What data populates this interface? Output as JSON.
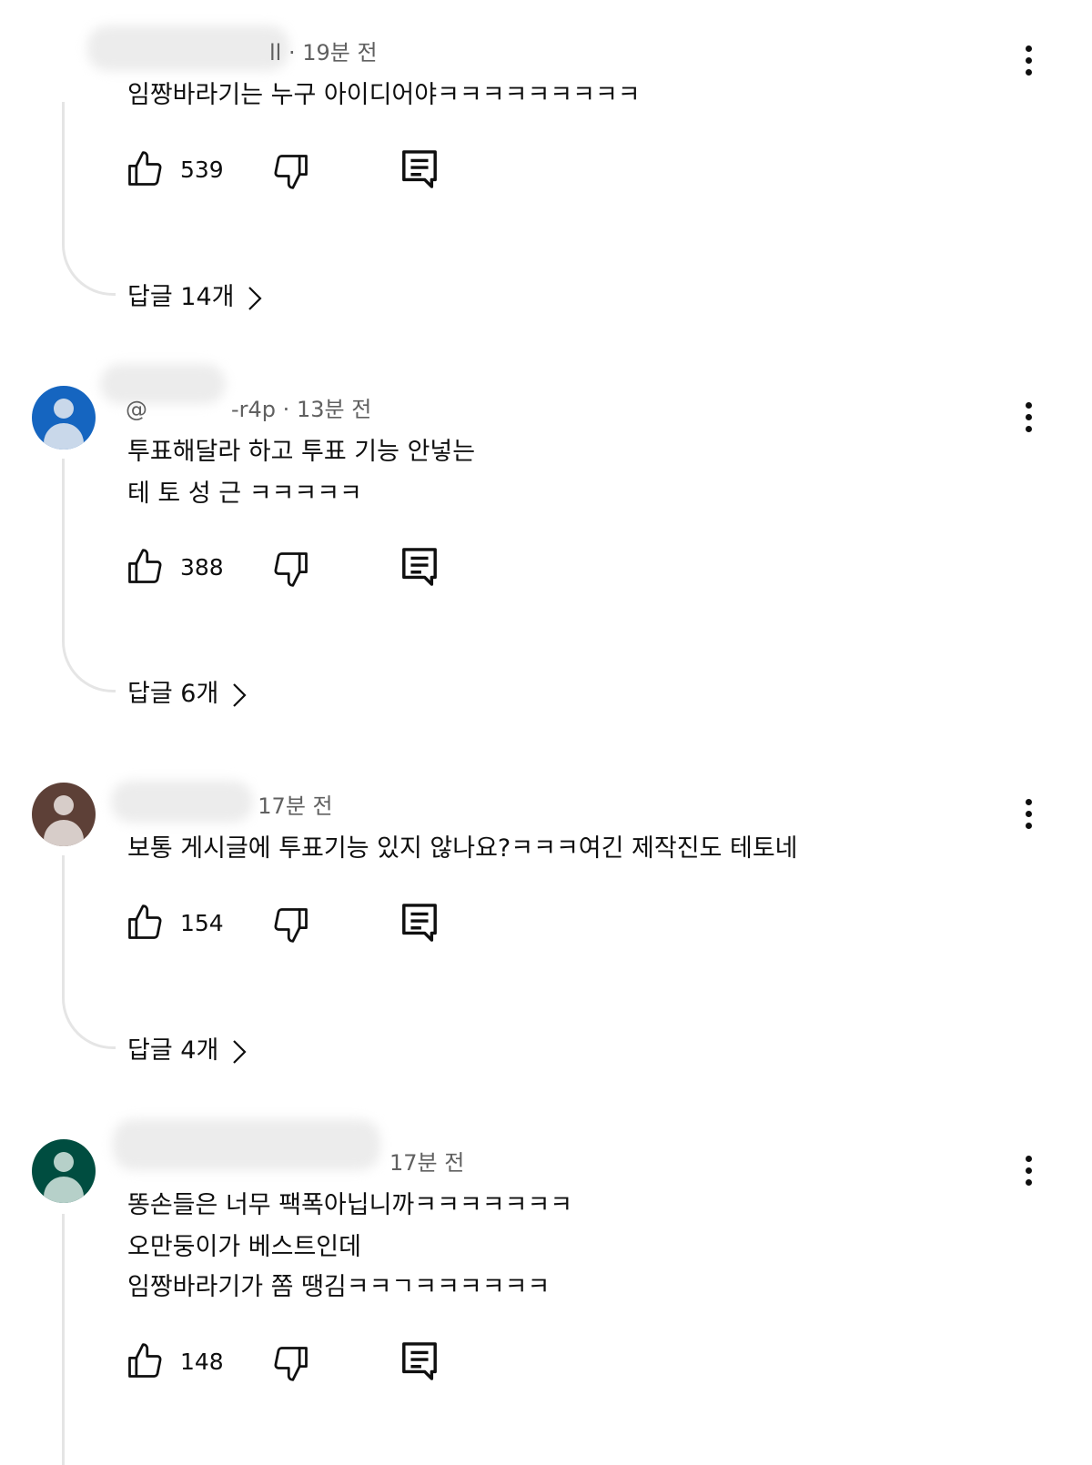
{
  "comments": [
    {
      "handle_suffix": "ll",
      "separator": "·",
      "time": "19분 전",
      "text_lines": [
        "임짱바라기는 누구 아이디어야ㅋㅋㅋㅋㅋㅋㅋㅋㅋ"
      ],
      "likes": "539",
      "replies_label": "답글 14개",
      "avatar_color": null
    },
    {
      "handle_prefix": "@",
      "handle_suffix": "-r4p",
      "separator": "·",
      "time": "13분 전",
      "text_lines": [
        "투표해달라 하고 투표 기능 안넣는",
        "테 토 성 근 ㅋㅋㅋㅋㅋ"
      ],
      "likes": "388",
      "replies_label": "답글 6개",
      "avatar_color": "#1565c0"
    },
    {
      "separator": "·",
      "time": "17분 전",
      "text_lines": [
        "보통 게시글에 투표기능 있지 않나요?ㅋㅋㅋ여긴 제작진도 테토네"
      ],
      "likes": "154",
      "replies_label": "답글 4개",
      "avatar_color": "#5d4037"
    },
    {
      "time": "17분 전",
      "text_lines": [
        "똥손들은 너무 팩폭아닙니까ㅋㅋㅋㅋㅋㅋㅋ",
        "오만둥이가 베스트인데",
        "임짱바라기가 쫌 땡김ㅋㅋㄱㅋㅋㅋㅋㅋㅋ"
      ],
      "likes": "148",
      "avatar_color": "#004d40"
    }
  ],
  "icons": {
    "like": "thumbs-up-icon",
    "dislike": "thumbs-down-icon",
    "reply": "comment-icon",
    "more": "more-vert-icon",
    "chevron": "chevron-right-icon"
  }
}
